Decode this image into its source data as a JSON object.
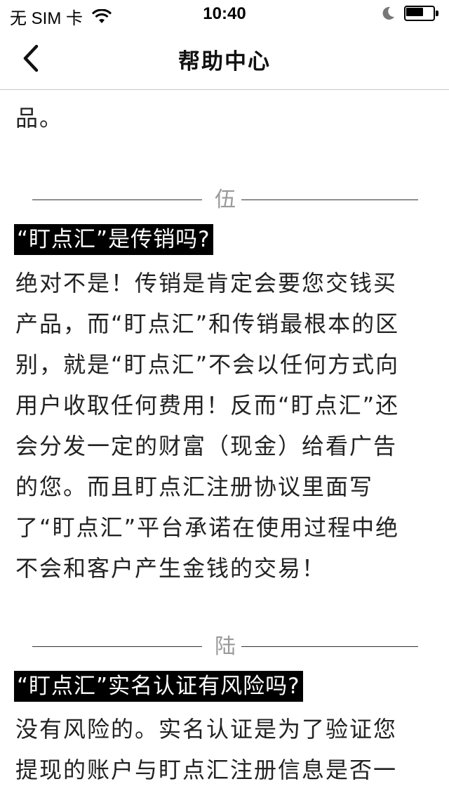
{
  "status_bar": {
    "carrier": "无 SIM 卡",
    "time": "10:40"
  },
  "nav": {
    "title": "帮助中心"
  },
  "content": {
    "top_fragment": "品。",
    "sections": [
      {
        "numeral": "伍",
        "question": "“盯点汇”是传销吗?",
        "answer_lines": [
          "绝对不是！传销是肯定会要您交钱买",
          "产品，而“盯点汇”和传销最根本的区",
          "别，就是“盯点汇”不会以任何方式向",
          "用户收取任何费用！反而“盯点汇”还",
          "会分发一定的财富（现金）给看广告",
          "的您。而且盯点汇注册协议里面写",
          "了“盯点汇”平台承诺在使用过程中绝",
          "不会和客户产生金钱的交易！"
        ]
      },
      {
        "numeral": "陆",
        "question": "“盯点汇”实名认证有风险吗?",
        "answer_lines": [
          "没有风险的。实名认证是为了验证您",
          "提现的账户与盯点汇注册信息是否一"
        ]
      }
    ]
  },
  "icons": {
    "back": "chevron-left-icon",
    "wifi": "wifi-icon",
    "moon": "moon-icon",
    "battery": "battery-icon"
  }
}
